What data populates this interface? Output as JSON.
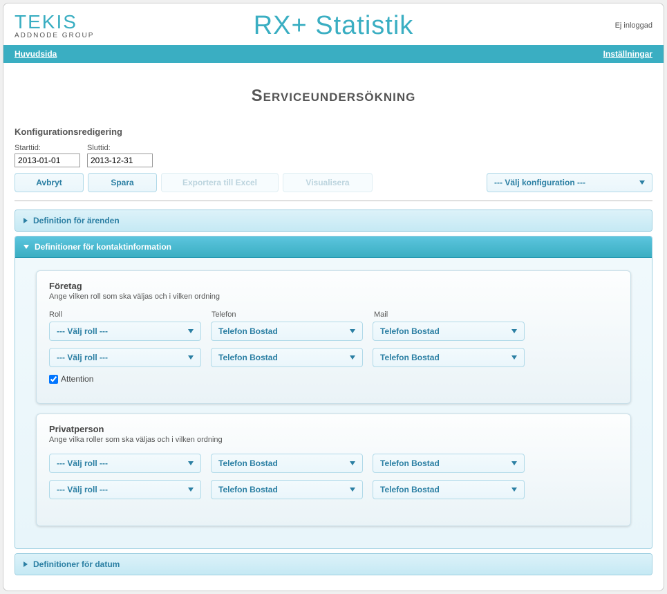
{
  "header": {
    "logo_top": "TEKIS",
    "logo_bottom": "ADDNODE GROUP",
    "app_title": "RX+ Statistik",
    "login_status": "Ej inloggad"
  },
  "nav": {
    "home": "Huvudsida",
    "settings": "Inställningar"
  },
  "page": {
    "title": "Serviceundersökning",
    "config_heading": "Konfigurationsredigering",
    "start_label": "Starttid:",
    "end_label": "Sluttid:",
    "start_value": "2013-01-01",
    "end_value": "2013-12-31"
  },
  "buttons": {
    "cancel": "Avbryt",
    "save": "Spara",
    "export": "Exportera till Excel",
    "visualize": "Visualisera",
    "choose_config": "--- Välj konfiguration ---"
  },
  "accordion": {
    "def_cases": "Definition för ärenden",
    "def_contact": "Definitioner för kontaktinformation",
    "def_date": "Definitioner för datum"
  },
  "contact": {
    "company": {
      "title": "Företag",
      "subtitle": "Ange vilken roll som ska väljas och i vilken ordning",
      "labels": {
        "role": "Roll",
        "phone": "Telefon",
        "mail": "Mail"
      },
      "rows": [
        {
          "role": "--- Välj roll ---",
          "phone": "Telefon Bostad",
          "mail": "Telefon Bostad"
        },
        {
          "role": "--- Välj roll ---",
          "phone": "Telefon Bostad",
          "mail": "Telefon Bostad"
        }
      ],
      "attention_label": "Attention"
    },
    "private": {
      "title": "Privatperson",
      "subtitle": "Ange vilka roller som ska väljas och i vilken ordning",
      "rows": [
        {
          "role": "--- Välj roll ---",
          "phone": "Telefon Bostad",
          "mail": "Telefon Bostad"
        },
        {
          "role": "--- Välj roll ---",
          "phone": "Telefon Bostad",
          "mail": "Telefon Bostad"
        }
      ]
    }
  }
}
